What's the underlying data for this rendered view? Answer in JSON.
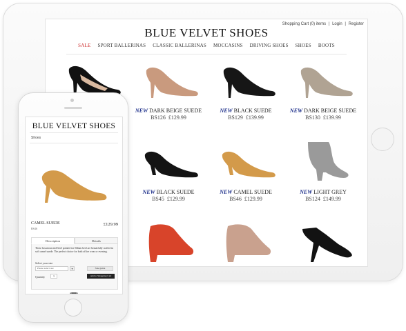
{
  "tablet": {
    "brand": "BLUE VELVET SHOES",
    "account": {
      "cart": "Shopping Cart (0) items",
      "separator": "|",
      "login": "Login",
      "register": "Register"
    },
    "nav": [
      {
        "label": "SALE",
        "highlight": true
      },
      {
        "label": "SPORT BALLERINAS"
      },
      {
        "label": "CLASSIC BALLERINAS"
      },
      {
        "label": "MOCCASINS"
      },
      {
        "label": "DRIVING SHOES"
      },
      {
        "label": "SHOES"
      },
      {
        "label": "BOOTS"
      }
    ],
    "products": [
      {
        "badge": "",
        "name": "",
        "code": "",
        "price": "",
        "shoe": "black-pump-mesh",
        "color": "#111111"
      },
      {
        "badge": "NEW",
        "name": "DARK BEIGE SUEDE",
        "code": "BS126",
        "price": "£129.99",
        "shoe": "pump",
        "color": "#c99a7e"
      },
      {
        "badge": "NEW",
        "name": "BLACK SUEDE",
        "code": "BS129",
        "price": "£139.99",
        "shoe": "pump",
        "color": "#161616"
      },
      {
        "badge": "NEW",
        "name": "DARK BEIGE SUEDE",
        "code": "BS130",
        "price": "£139.99",
        "shoe": "pump",
        "color": "#b0a393"
      },
      {
        "badge": "",
        "name": "",
        "code": "",
        "price": "",
        "shoe": "hidden",
        "color": "#ffffff"
      },
      {
        "badge": "NEW",
        "name": "BLACK SUEDE",
        "code": "BS45",
        "price": "£129.99",
        "shoe": "kitten",
        "color": "#141414"
      },
      {
        "badge": "NEW",
        "name": "CAMEL SUEDE",
        "code": "BS46",
        "price": "£129.99",
        "shoe": "kitten",
        "color": "#d39a4a"
      },
      {
        "badge": "NEW",
        "name": "LIGHT GREY",
        "code": "BS124",
        "price": "£149.99",
        "shoe": "bootie",
        "color": "#9a9a9a"
      },
      {
        "badge": "",
        "name": "",
        "code": "",
        "price": "",
        "shoe": "hidden",
        "color": "#ffffff"
      },
      {
        "badge": "",
        "name": "",
        "code": "",
        "price": "",
        "shoe": "wedge",
        "color": "#d8442a"
      },
      {
        "badge": "",
        "name": "",
        "code": "",
        "price": "",
        "shoe": "wedge",
        "color": "#c9a18e"
      },
      {
        "badge": "",
        "name": "",
        "code": "",
        "price": "",
        "shoe": "strappy",
        "color": "#121212"
      }
    ]
  },
  "phone": {
    "brand": "BLUE VELVET SHOES",
    "breadcrumb": "Shoes",
    "product": {
      "name": "CAMEL SUEDE",
      "code": "BS46",
      "price": "£129.99",
      "color": "#d39a4a"
    },
    "tabs": [
      "Description",
      "Details"
    ],
    "description": "These luxurious mid-heel pointed toe 60mm heel are beautifully crafted in soft camel suede. The perfect choice for both office wear or evening.",
    "size_label": "Select your size",
    "size_placeholder": "Please select one",
    "size_arrow": "▾",
    "size_guide": "Size guide",
    "quantity_label": "Quantity",
    "quantity_value": "1",
    "add_button": "Add to Shopping Cart"
  }
}
